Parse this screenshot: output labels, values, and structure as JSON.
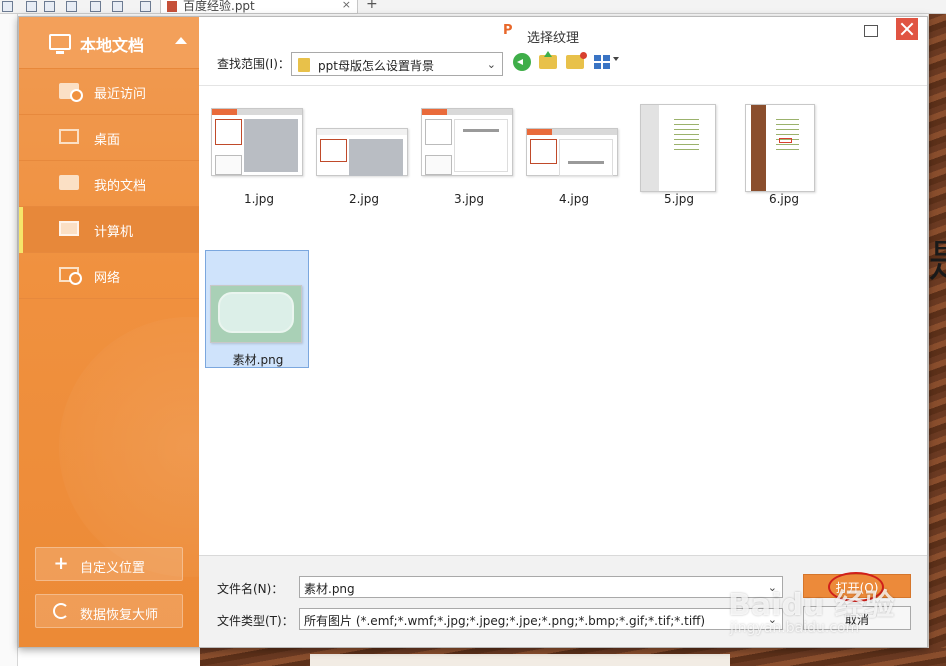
{
  "app": {
    "doc_tab_title": "百度经验.ppt",
    "doc_tab_close": "×",
    "new_tab": "+",
    "page_char": "是"
  },
  "dialog": {
    "title": "选择纹理",
    "logo_glyph": "P",
    "close_glyph": ""
  },
  "sidebar": {
    "header_title": "本地文档",
    "items": [
      {
        "label": "最近访问",
        "icon": "recent-folder-icon",
        "active": false
      },
      {
        "label": "桌面",
        "icon": "desktop-icon",
        "active": false
      },
      {
        "label": "我的文档",
        "icon": "folder-icon",
        "active": false
      },
      {
        "label": "计算机",
        "icon": "computer-icon",
        "active": true
      },
      {
        "label": "网络",
        "icon": "network-icon",
        "active": false
      }
    ],
    "custom_location": {
      "icon": "+",
      "label": "自定义位置"
    },
    "data_recovery": {
      "label": "数据恢复大师"
    }
  },
  "toolbar": {
    "lookin_label": "查找范围(I)：",
    "lookin_value": "ppt母版怎么设置背景",
    "chevron": "⌄"
  },
  "files": [
    {
      "name": "1.jpg",
      "kind": "slide"
    },
    {
      "name": "2.jpg",
      "kind": "slide"
    },
    {
      "name": "3.jpg",
      "kind": "slide"
    },
    {
      "name": "4.jpg",
      "kind": "slide"
    },
    {
      "name": "5.jpg",
      "kind": "tall"
    },
    {
      "name": "6.jpg",
      "kind": "wood"
    },
    {
      "name": "素材.png",
      "kind": "material",
      "selected": true
    }
  ],
  "bottom": {
    "filename_label": "文件名(N)：",
    "filename_value": "素材.png",
    "filetype_label": "文件类型(T)：",
    "filetype_value": "所有图片 (*.emf;*.wmf;*.jpg;*.jpeg;*.jpe;*.png;*.bmp;*.gif;*.tif;*.tiff)",
    "open_label": "打开(O)",
    "cancel_label": "取消",
    "chevron": "⌄"
  },
  "watermark": {
    "logo": "Baidu 经验",
    "url": "jingyan.baidu.com"
  },
  "colors": {
    "sidebar": "#f0913f",
    "accent": "#ec8a3a",
    "close": "#e05442",
    "selection": "#cfe3fb"
  }
}
